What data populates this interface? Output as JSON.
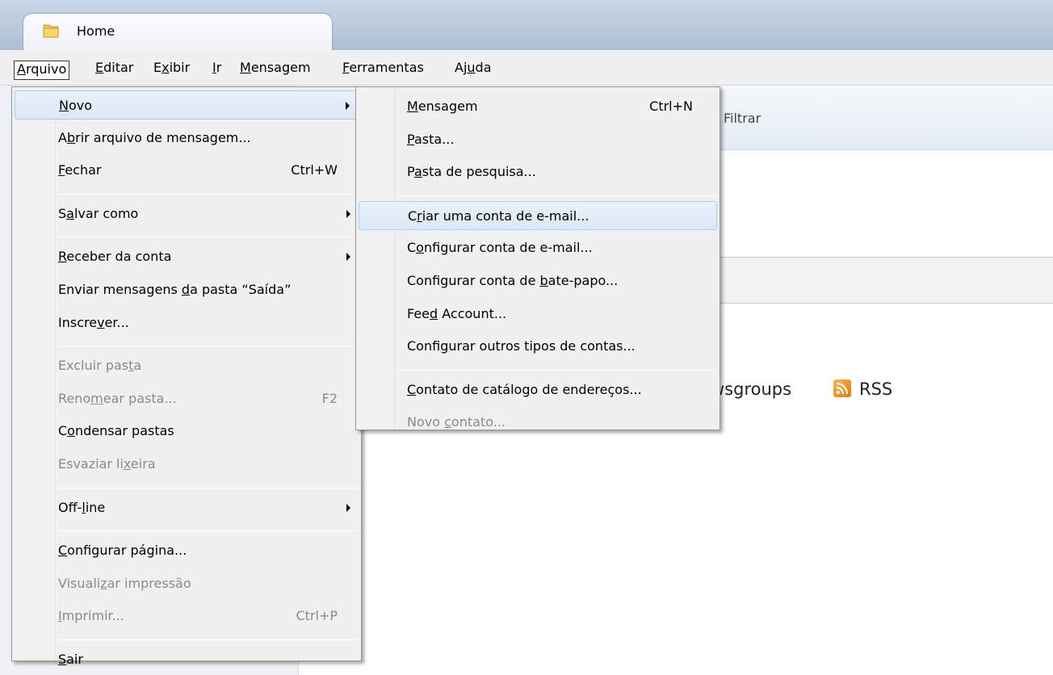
{
  "tab": {
    "label": "Home"
  },
  "menubar": [
    {
      "pre": "",
      "key": "A",
      "post": "rquivo",
      "active": true
    },
    {
      "pre": "",
      "key": "E",
      "post": "ditar"
    },
    {
      "pre": "E",
      "key": "x",
      "post": "ibir"
    },
    {
      "pre": "",
      "key": "I",
      "post": "r"
    },
    {
      "pre": "",
      "key": "M",
      "post": "ensagem"
    },
    {
      "pre": "",
      "key": "F",
      "post": "erramentas"
    },
    {
      "pre": "Aj",
      "key": "u",
      "post": "da"
    }
  ],
  "background": {
    "filter_label": "Filtrar",
    "newsgroups_text": "wsgroups",
    "rss_label": "RSS"
  },
  "arquivo_menu": [
    {
      "pre": "",
      "key": "N",
      "post": "ovo",
      "submenu": true,
      "highlighted": true
    },
    {
      "pre": "A",
      "key": "b",
      "post": "rir arquivo de mensagem..."
    },
    {
      "pre": "",
      "key": "F",
      "post": "echar",
      "accel": "Ctrl+W"
    },
    {
      "sep": true
    },
    {
      "pre": "S",
      "key": "a",
      "post": "lvar como",
      "submenu": true
    },
    {
      "sep": true
    },
    {
      "pre": "",
      "key": "R",
      "post": "eceber da conta",
      "submenu": true
    },
    {
      "pre": "Enviar mensagens ",
      "key": "d",
      "post": "a pasta “Saída”"
    },
    {
      "pre": "Inscre",
      "key": "v",
      "post": "er..."
    },
    {
      "sep": true
    },
    {
      "pre": "Excluir pas",
      "key": "t",
      "post": "a",
      "disabled": true
    },
    {
      "pre": "Reno",
      "key": "m",
      "post": "ear pasta...",
      "accel": "F2",
      "disabled": true
    },
    {
      "pre": "C",
      "key": "o",
      "post": "ndensar pastas"
    },
    {
      "pre": "Esvaziar li",
      "key": "x",
      "post": "eira",
      "disabled": true
    },
    {
      "sep": true
    },
    {
      "pre": "Off-",
      "key": "l",
      "post": "ine",
      "submenu": true
    },
    {
      "sep": true
    },
    {
      "pre": "",
      "key": "C",
      "post": "onfigurar página..."
    },
    {
      "pre": "Visuali",
      "key": "z",
      "post": "ar impressão",
      "disabled": true
    },
    {
      "pre": "",
      "key": "I",
      "post": "mprimir...",
      "accel": "Ctrl+P",
      "disabled": true
    },
    {
      "sep": true
    },
    {
      "pre": "",
      "key": "S",
      "post": "air"
    }
  ],
  "novo_menu": [
    {
      "pre": "",
      "key": "M",
      "post": "ensagem",
      "accel": "Ctrl+N"
    },
    {
      "pre": "",
      "key": "P",
      "post": "asta..."
    },
    {
      "pre": "P",
      "key": "a",
      "post": "sta de pesquisa..."
    },
    {
      "sep": true
    },
    {
      "pre": "C",
      "key": "r",
      "post": "iar uma conta de e-mail...",
      "highlighted": true
    },
    {
      "pre": "C",
      "key": "o",
      "post": "nfigurar conta de e-mail..."
    },
    {
      "pre": "Configurar conta de ",
      "key": "b",
      "post": "ate-papo..."
    },
    {
      "pre": "Fee",
      "key": "d",
      "post": " Account..."
    },
    {
      "pre": "Confi",
      "key": "g",
      "post": "urar outros tipos de contas..."
    },
    {
      "sep": true
    },
    {
      "pre": "",
      "key": "C",
      "post": "ontato de catálogo de endereços..."
    },
    {
      "pre": "Novo ",
      "key": "c",
      "post": "ontato...",
      "disabled": true
    }
  ]
}
